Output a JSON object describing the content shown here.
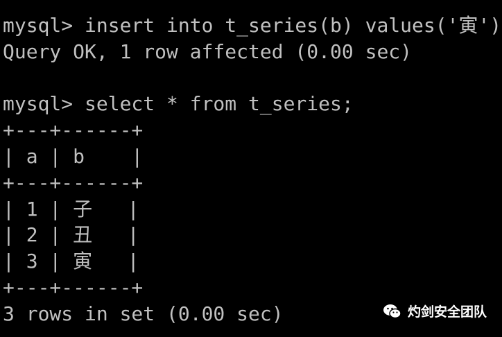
{
  "terminal": {
    "lines": [
      "mysql> insert into t_series(b) values('寅');",
      "Query OK, 1 row affected (0.00 sec)",
      "",
      "mysql> select * from t_series;",
      "+---+------+",
      "| a | b    |",
      "+---+------+",
      "| 1 | 子   |",
      "| 2 | 丑   |",
      "| 3 | 寅   |",
      "+---+------+",
      "3 rows in set (0.00 sec)"
    ]
  },
  "watermark": {
    "icon": "wechat-icon",
    "text": "灼剑安全团队"
  }
}
